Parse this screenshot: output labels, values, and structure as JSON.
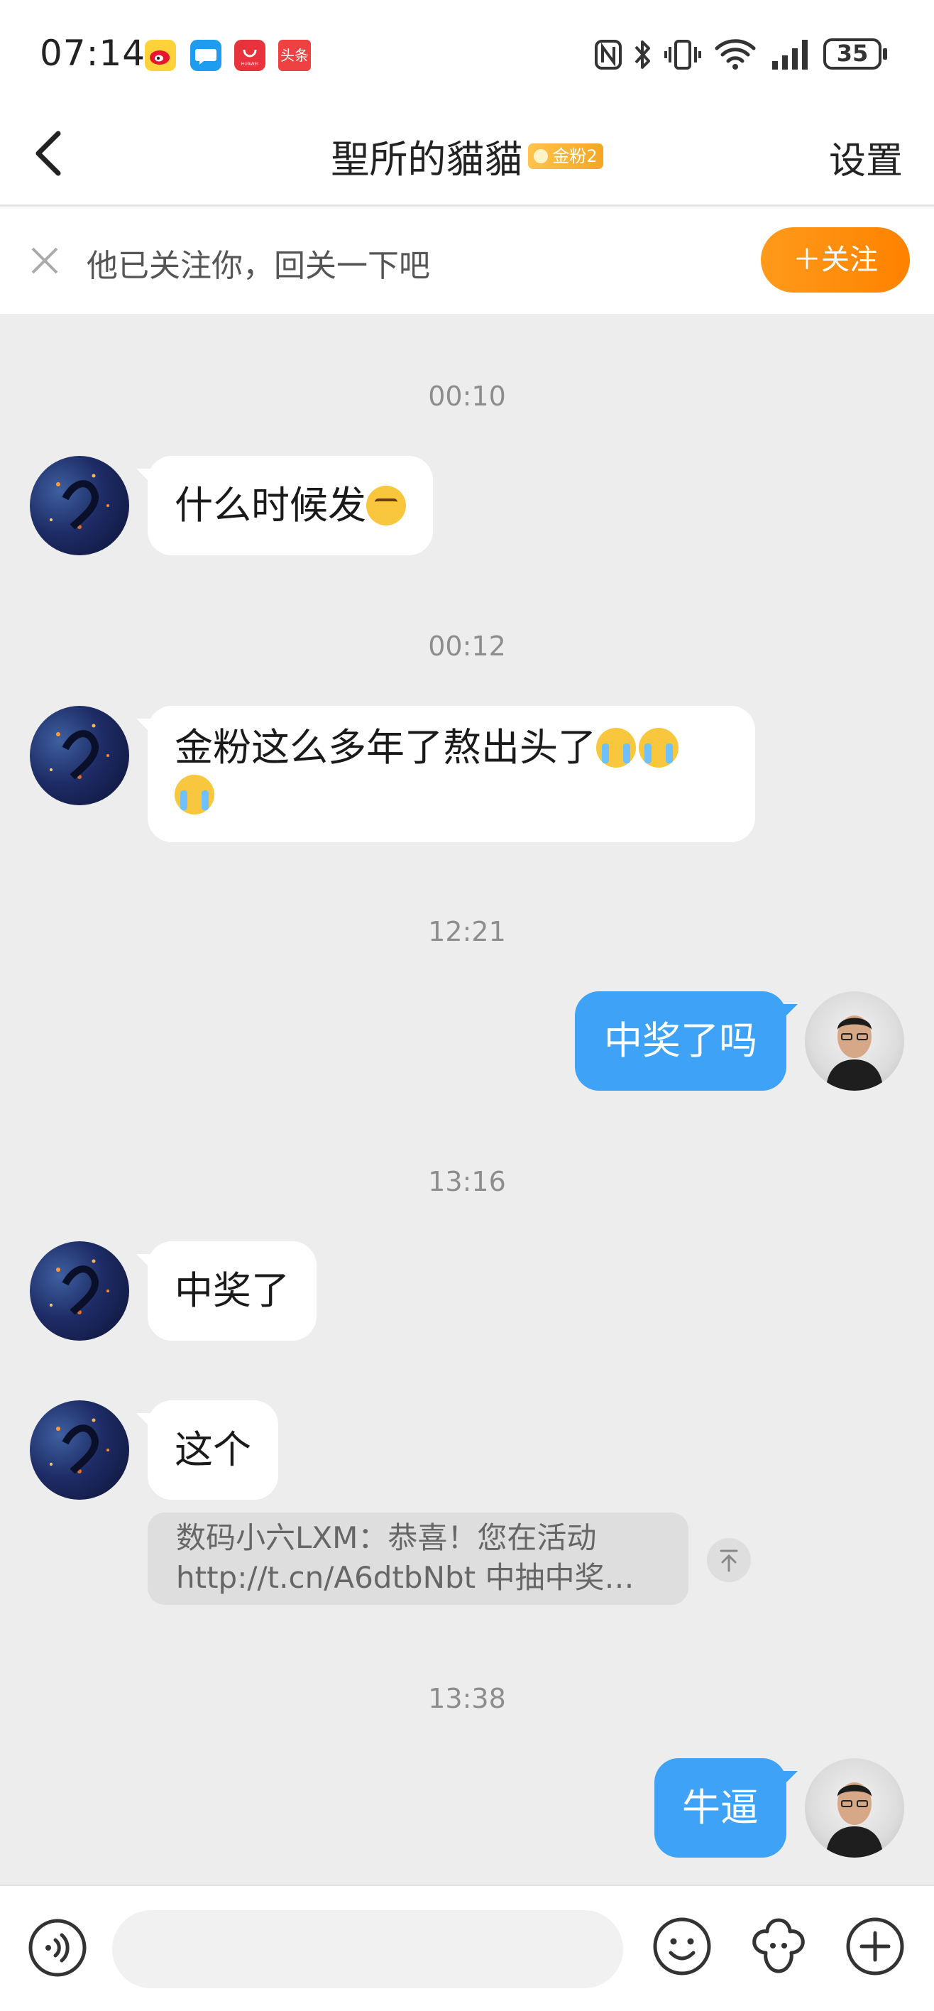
{
  "status_bar": {
    "time": "07:14",
    "app_icons": [
      "weibo-icon",
      "message-icon",
      "huawei-appgallery-icon",
      "toutiao-icon"
    ],
    "huawei_label": "HUAWEI",
    "toutiao_label": "头条",
    "battery": "35",
    "system_icons": [
      "nfc-icon",
      "bluetooth-icon",
      "vibrate-icon",
      "wifi-icon",
      "signal-icon",
      "battery-icon"
    ]
  },
  "header": {
    "title": "聖所的貓貓",
    "badge": "金粉2",
    "settings_label": "设置"
  },
  "follow_bar": {
    "text": "他已关注你，回关一下吧",
    "button_label": "＋关注"
  },
  "messages": [
    {
      "time": "00:10",
      "from": "them",
      "text": "什么时候发",
      "emoji": [
        "kissing-face"
      ]
    },
    {
      "time": "00:12",
      "from": "them",
      "text": "金粉这么多年了熬出头了",
      "emoji": [
        "loudly-crying-face",
        "loudly-crying-face",
        "loudly-crying-face"
      ]
    },
    {
      "time": "12:21",
      "from": "me",
      "text": "中奖了吗"
    },
    {
      "time": "13:16",
      "from": "them",
      "text": "中奖了"
    },
    {
      "from": "them",
      "text": "这个",
      "quote": {
        "line1": "数码小六LXM：恭喜！您在活动",
        "line2": "http://t.cn/A6dtbNbt 中抽中奖…"
      }
    },
    {
      "time": "13:38",
      "from": "me",
      "text": "牛逼"
    }
  ],
  "input_bar": {
    "placeholder": "",
    "icons": [
      "voice-icon",
      "emoji-icon",
      "sticker-icon",
      "plus-icon"
    ]
  },
  "colors": {
    "accent_orange": "#ff8a0d",
    "bubble_blue": "#3ea3f6",
    "background": "#ededed"
  }
}
